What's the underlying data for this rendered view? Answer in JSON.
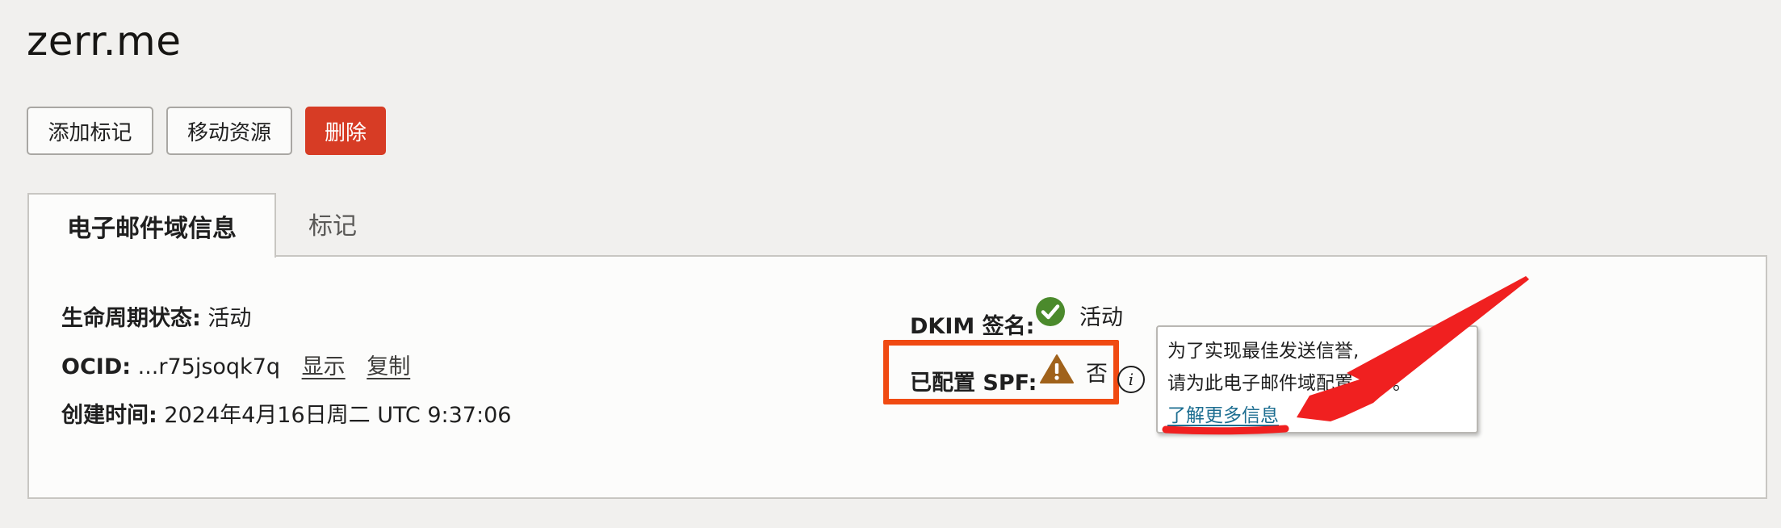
{
  "header": {
    "title": "zerr.me"
  },
  "actions": {
    "add_tag": "添加标记",
    "move_resource": "移动资源",
    "delete": "删除"
  },
  "tabs": [
    {
      "label": "电子邮件域信息"
    },
    {
      "label": "标记"
    }
  ],
  "details": {
    "lifecycle": {
      "label": "生命周期状态:",
      "value": "活动"
    },
    "ocid": {
      "label": "OCID:",
      "value": "...r75jsoqk7q",
      "show": "显示",
      "copy": "复制"
    },
    "created": {
      "label": "创建时间:",
      "value": "2024年4月16日周二 UTC 9:37:06"
    },
    "dkim": {
      "label": "DKIM 签名:",
      "value": "活动",
      "status_icon": "check-circle-icon"
    },
    "spf": {
      "label": "已配置 SPF:",
      "value": "否",
      "status_icon": "warning-triangle-icon"
    }
  },
  "tooltip": {
    "line1": "为了实现最佳发送信誉,",
    "line2": "请为此电子邮件域配置 SPF。",
    "link": "了解更多信息"
  },
  "colors": {
    "danger": "#d73c25",
    "annotation_red": "#f02020",
    "highlight_orange": "#f04a12",
    "success": "#4b8a2c",
    "warning": "#a0621b",
    "link": "#1d6e91"
  }
}
